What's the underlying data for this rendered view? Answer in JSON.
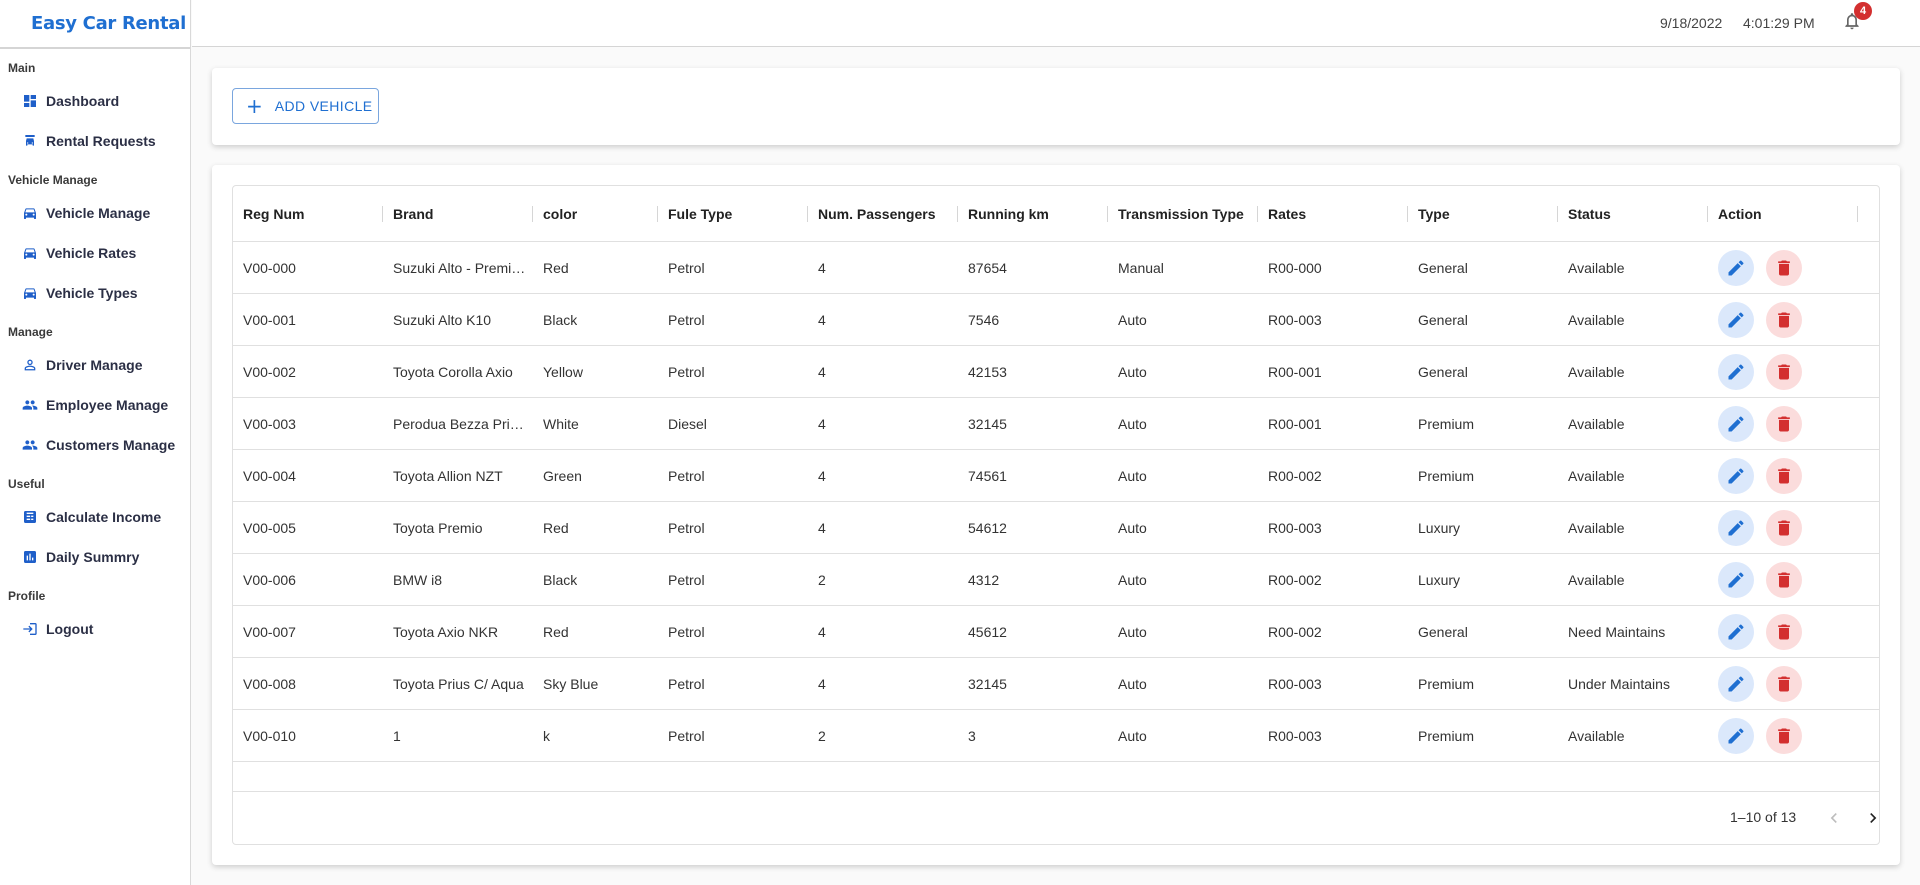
{
  "app": {
    "title": "Easy Car Rental"
  },
  "header": {
    "date": "9/18/2022",
    "time": "4:01:29 PM",
    "notifications": "4"
  },
  "sidebar": {
    "sections": [
      {
        "title": "Main",
        "items": [
          {
            "label": "Dashboard",
            "icon": "dashboard-icon"
          },
          {
            "label": "Rental Requests",
            "icon": "rental-requests-icon"
          }
        ]
      },
      {
        "title": "Vehicle Manage",
        "items": [
          {
            "label": "Vehicle Manage",
            "icon": "car-icon"
          },
          {
            "label": "Vehicle Rates",
            "icon": "car-icon"
          },
          {
            "label": "Vehicle Types",
            "icon": "car-icon"
          }
        ]
      },
      {
        "title": "Manage",
        "items": [
          {
            "label": "Driver Manage",
            "icon": "person-icon"
          },
          {
            "label": "Employee Manage",
            "icon": "people-icon"
          },
          {
            "label": "Customers Manage",
            "icon": "people-icon"
          }
        ]
      },
      {
        "title": "Useful",
        "items": [
          {
            "label": "Calculate Income",
            "icon": "calculator-icon"
          },
          {
            "label": "Daily Summry",
            "icon": "chart-icon"
          }
        ]
      },
      {
        "title": "Profile",
        "items": [
          {
            "label": "Logout",
            "icon": "logout-icon"
          }
        ]
      }
    ]
  },
  "toolbar": {
    "add_label": "ADD VEHICLE"
  },
  "table": {
    "columns": [
      "Reg Num",
      "Brand",
      "color",
      "Fule Type",
      "Num. Passengers",
      "Running km",
      "Transmission Type",
      "Rates",
      "Type",
      "Status",
      "Action"
    ],
    "rows": [
      [
        "V00-000",
        "Suzuki Alto - Premium",
        "Red",
        "Petrol",
        "4",
        "87654",
        "Manual",
        "R00-000",
        "General",
        "Available"
      ],
      [
        "V00-001",
        "Suzuki Alto K10",
        "Black",
        "Petrol",
        "4",
        "7546",
        "Auto",
        "R00-003",
        "General",
        "Available"
      ],
      [
        "V00-002",
        "Toyota Corolla Axio",
        "Yellow",
        "Petrol",
        "4",
        "42153",
        "Auto",
        "R00-001",
        "General",
        "Available"
      ],
      [
        "V00-003",
        "Perodua Bezza Prime",
        "White",
        "Diesel",
        "4",
        "32145",
        "Auto",
        "R00-001",
        "Premium",
        "Available"
      ],
      [
        "V00-004",
        "Toyota Allion NZT",
        "Green",
        "Petrol",
        "4",
        "74561",
        "Auto",
        "R00-002",
        "Premium",
        "Available"
      ],
      [
        "V00-005",
        "Toyota Premio",
        "Red",
        "Petrol",
        "4",
        "54612",
        "Auto",
        "R00-003",
        "Luxury",
        "Available"
      ],
      [
        "V00-006",
        "BMW i8",
        "Black",
        "Petrol",
        "2",
        "4312",
        "Auto",
        "R00-002",
        "Luxury",
        "Available"
      ],
      [
        "V00-007",
        "Toyota Axio NKR",
        "Red",
        "Petrol",
        "4",
        "45612",
        "Auto",
        "R00-002",
        "General",
        "Need Maintains"
      ],
      [
        "V00-008",
        "Toyota Prius C/ Aqua",
        "Sky Blue",
        "Petrol",
        "4",
        "32145",
        "Auto",
        "R00-003",
        "Premium",
        "Under Maintains"
      ],
      [
        "V00-010",
        "1",
        "k",
        "Petrol",
        "2",
        "3",
        "Auto",
        "R00-003",
        "Premium",
        "Available"
      ]
    ]
  },
  "pagination": {
    "label": "1–10 of 13"
  },
  "colors": {
    "accent": "#1f6fd1",
    "danger": "#d32f2f"
  }
}
